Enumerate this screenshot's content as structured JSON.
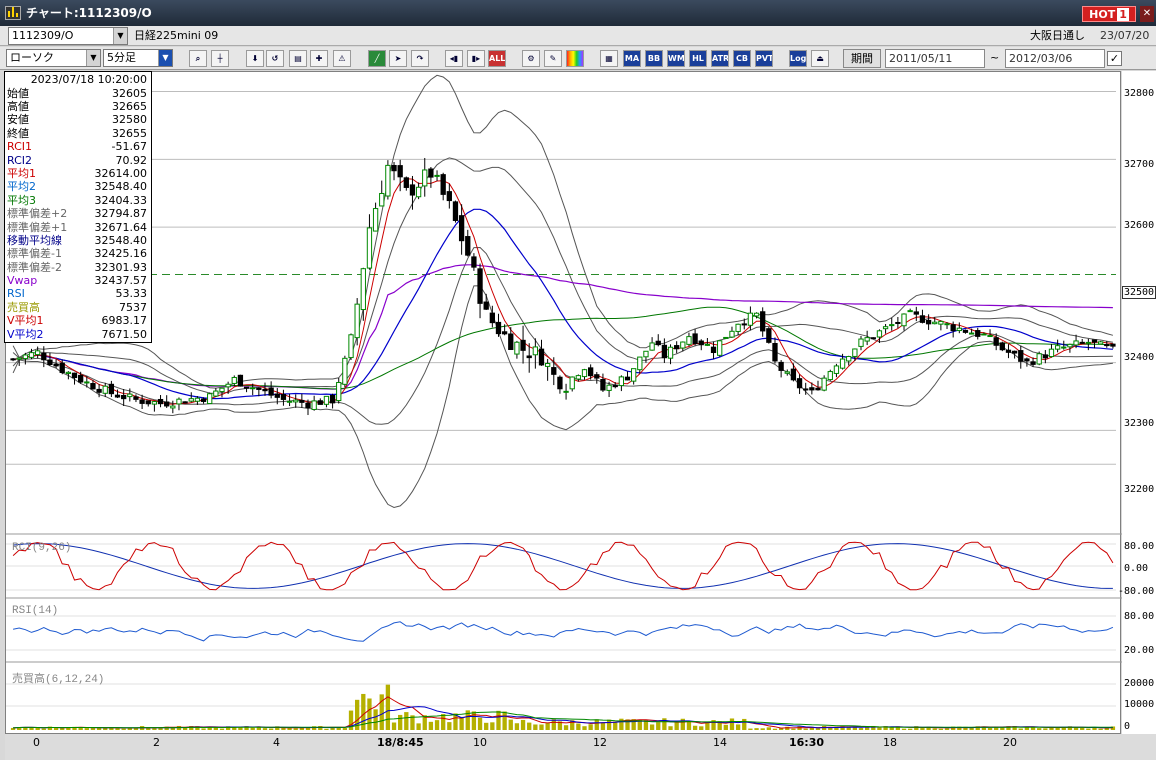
{
  "window": {
    "title": "チャート:1112309/O",
    "hot_label": "HOT",
    "hot_num": "1",
    "close_glyph": "✕"
  },
  "toolbar1": {
    "symbol": "1112309/O",
    "symbol_name": "日経225mini 09",
    "market": "大阪日通し",
    "date": "23/07/20"
  },
  "toolbar2": {
    "chart_type": "ローソク",
    "timeframe": "5分足",
    "period_button": "期間",
    "date_from": "2011/05/11",
    "date_to": "2012/03/06",
    "tilde": "~",
    "check": "✓",
    "buttons": [
      "zoom",
      "cursor",
      "buy-down",
      "buy-up",
      "chart-a",
      "indicator",
      "warning",
      "line-tool",
      "arrow",
      "redo",
      "add-left",
      "add-right",
      "ALL",
      "gear",
      "wrench",
      "palette",
      "grid",
      "MA",
      "BB",
      "WMA",
      "HL",
      "ATR",
      "CB",
      "PVT",
      "Log",
      "exit"
    ]
  },
  "info_panel": {
    "datetime": "2023/07/18 10:20:00",
    "rows": [
      {
        "label": "始値",
        "value": "32605",
        "color": "#000000"
      },
      {
        "label": "高値",
        "value": "32665",
        "color": "#000000"
      },
      {
        "label": "安値",
        "value": "32580",
        "color": "#000000"
      },
      {
        "label": "終値",
        "value": "32655",
        "color": "#000000"
      },
      {
        "label": "RCI1",
        "value": "-51.67",
        "color": "#cc0000"
      },
      {
        "label": "RCI2",
        "value": "70.92",
        "color": "#000088"
      },
      {
        "label": "平均1",
        "value": "32614.00",
        "color": "#cc0000"
      },
      {
        "label": "平均2",
        "value": "32548.40",
        "color": "#0066cc"
      },
      {
        "label": "平均3",
        "value": "32404.33",
        "color": "#007700"
      },
      {
        "label": "標準偏差+2",
        "value": "32794.87",
        "color": "#666666"
      },
      {
        "label": "標準偏差+1",
        "value": "32671.64",
        "color": "#666666"
      },
      {
        "label": "移動平均線",
        "value": "32548.40",
        "color": "#000088"
      },
      {
        "label": "標準偏差-1",
        "value": "32425.16",
        "color": "#666666"
      },
      {
        "label": "標準偏差-2",
        "value": "32301.93",
        "color": "#666666"
      },
      {
        "label": "Vwap",
        "value": "32437.57",
        "color": "#8800cc"
      },
      {
        "label": "RSI",
        "value": "53.33",
        "color": "#0066cc"
      },
      {
        "label": "売買高",
        "value": "7537",
        "color": "#999900"
      },
      {
        "label": "V平均1",
        "value": "6983.17",
        "color": "#cc0000"
      },
      {
        "label": "V平均2",
        "value": "7671.50",
        "color": "#0000cc"
      }
    ]
  },
  "price_axis": {
    "ticks": [
      "32800",
      "32700",
      "32600",
      "32500",
      "32400",
      "32300",
      "32200"
    ],
    "current": "32500",
    "current_color": "#007700"
  },
  "panels": {
    "rci_label": "RCI(9,26)",
    "rci_ticks": [
      "80.00",
      "0.00",
      "-80.00"
    ],
    "rsi_label": "RSI(14)",
    "rsi_ticks": [
      "80.00",
      "20.00"
    ],
    "vol_label": "売買高(6,12,24)",
    "vol_ticks": [
      "20000",
      "10000",
      "0"
    ]
  },
  "x_axis": {
    "labels": [
      {
        "text": "0",
        "bold": false
      },
      {
        "text": "2",
        "bold": false
      },
      {
        "text": "4",
        "bold": false
      },
      {
        "text": "18/8:45",
        "bold": true
      },
      {
        "text": "10",
        "bold": false
      },
      {
        "text": "12",
        "bold": false
      },
      {
        "text": "14",
        "bold": false
      },
      {
        "text": "16:30",
        "bold": true
      },
      {
        "text": "18",
        "bold": false
      },
      {
        "text": "20",
        "bold": false
      }
    ]
  },
  "chart_data": {
    "type": "candlestick",
    "timeframe": "5分足",
    "price_range": [
      32150,
      32820
    ],
    "dashed_level": 32530,
    "price_path": [
      [
        0,
        32405
      ],
      [
        4,
        32415
      ],
      [
        8,
        32390
      ],
      [
        12,
        32370
      ],
      [
        16,
        32355
      ],
      [
        20,
        32345
      ],
      [
        24,
        32340
      ],
      [
        28,
        32345
      ],
      [
        32,
        32350
      ],
      [
        36,
        32375
      ],
      [
        40,
        32360
      ],
      [
        44,
        32345
      ],
      [
        48,
        32340
      ],
      [
        52,
        32345
      ],
      [
        55,
        32430
      ],
      [
        58,
        32600
      ],
      [
        61,
        32690
      ],
      [
        64,
        32650
      ],
      [
        68,
        32680
      ],
      [
        71,
        32630
      ],
      [
        74,
        32560
      ],
      [
        77,
        32470
      ],
      [
        80,
        32440
      ],
      [
        83,
        32420
      ],
      [
        86,
        32410
      ],
      [
        88,
        32380
      ],
      [
        90,
        32370
      ],
      [
        93,
        32395
      ],
      [
        96,
        32360
      ],
      [
        100,
        32380
      ],
      [
        104,
        32430
      ],
      [
        106,
        32410
      ],
      [
        110,
        32440
      ],
      [
        114,
        32420
      ],
      [
        118,
        32460
      ],
      [
        121,
        32470
      ],
      [
        124,
        32400
      ],
      [
        127,
        32370
      ],
      [
        130,
        32355
      ],
      [
        134,
        32400
      ],
      [
        138,
        32430
      ],
      [
        142,
        32450
      ],
      [
        146,
        32470
      ],
      [
        150,
        32460
      ],
      [
        154,
        32450
      ],
      [
        158,
        32440
      ],
      [
        161,
        32420
      ],
      [
        165,
        32400
      ],
      [
        170,
        32420
      ],
      [
        175,
        32430
      ],
      [
        180,
        32415
      ]
    ],
    "rci_range": [
      -100,
      100
    ],
    "rsi_range": [
      0,
      100
    ],
    "volume_range": [
      0,
      25000
    ]
  },
  "colors": {
    "up": "#008800",
    "down": "#000000",
    "ma1": "#cc0000",
    "ma2": "#0000cc",
    "ma3": "#007700",
    "vwap": "#8800cc",
    "bband": "#555555",
    "rsi": "#1e5ad0",
    "volume": "#b5b000"
  }
}
